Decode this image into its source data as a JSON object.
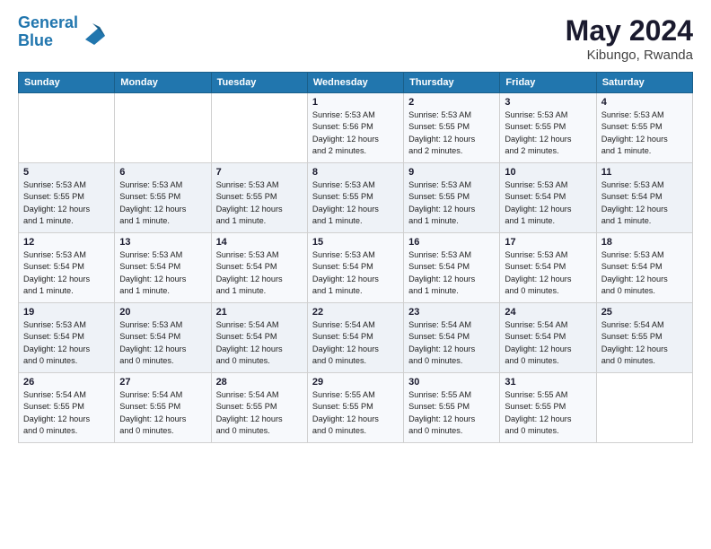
{
  "header": {
    "logo_line1": "General",
    "logo_line2": "Blue",
    "month_year": "May 2024",
    "location": "Kibungo, Rwanda"
  },
  "days_of_week": [
    "Sunday",
    "Monday",
    "Tuesday",
    "Wednesday",
    "Thursday",
    "Friday",
    "Saturday"
  ],
  "weeks": [
    [
      {
        "day": "",
        "text": ""
      },
      {
        "day": "",
        "text": ""
      },
      {
        "day": "",
        "text": ""
      },
      {
        "day": "1",
        "text": "Sunrise: 5:53 AM\nSunset: 5:56 PM\nDaylight: 12 hours\nand 2 minutes."
      },
      {
        "day": "2",
        "text": "Sunrise: 5:53 AM\nSunset: 5:55 PM\nDaylight: 12 hours\nand 2 minutes."
      },
      {
        "day": "3",
        "text": "Sunrise: 5:53 AM\nSunset: 5:55 PM\nDaylight: 12 hours\nand 2 minutes."
      },
      {
        "day": "4",
        "text": "Sunrise: 5:53 AM\nSunset: 5:55 PM\nDaylight: 12 hours\nand 1 minute."
      }
    ],
    [
      {
        "day": "5",
        "text": "Sunrise: 5:53 AM\nSunset: 5:55 PM\nDaylight: 12 hours\nand 1 minute."
      },
      {
        "day": "6",
        "text": "Sunrise: 5:53 AM\nSunset: 5:55 PM\nDaylight: 12 hours\nand 1 minute."
      },
      {
        "day": "7",
        "text": "Sunrise: 5:53 AM\nSunset: 5:55 PM\nDaylight: 12 hours\nand 1 minute."
      },
      {
        "day": "8",
        "text": "Sunrise: 5:53 AM\nSunset: 5:55 PM\nDaylight: 12 hours\nand 1 minute."
      },
      {
        "day": "9",
        "text": "Sunrise: 5:53 AM\nSunset: 5:55 PM\nDaylight: 12 hours\nand 1 minute."
      },
      {
        "day": "10",
        "text": "Sunrise: 5:53 AM\nSunset: 5:54 PM\nDaylight: 12 hours\nand 1 minute."
      },
      {
        "day": "11",
        "text": "Sunrise: 5:53 AM\nSunset: 5:54 PM\nDaylight: 12 hours\nand 1 minute."
      }
    ],
    [
      {
        "day": "12",
        "text": "Sunrise: 5:53 AM\nSunset: 5:54 PM\nDaylight: 12 hours\nand 1 minute."
      },
      {
        "day": "13",
        "text": "Sunrise: 5:53 AM\nSunset: 5:54 PM\nDaylight: 12 hours\nand 1 minute."
      },
      {
        "day": "14",
        "text": "Sunrise: 5:53 AM\nSunset: 5:54 PM\nDaylight: 12 hours\nand 1 minute."
      },
      {
        "day": "15",
        "text": "Sunrise: 5:53 AM\nSunset: 5:54 PM\nDaylight: 12 hours\nand 1 minute."
      },
      {
        "day": "16",
        "text": "Sunrise: 5:53 AM\nSunset: 5:54 PM\nDaylight: 12 hours\nand 1 minute."
      },
      {
        "day": "17",
        "text": "Sunrise: 5:53 AM\nSunset: 5:54 PM\nDaylight: 12 hours\nand 0 minutes."
      },
      {
        "day": "18",
        "text": "Sunrise: 5:53 AM\nSunset: 5:54 PM\nDaylight: 12 hours\nand 0 minutes."
      }
    ],
    [
      {
        "day": "19",
        "text": "Sunrise: 5:53 AM\nSunset: 5:54 PM\nDaylight: 12 hours\nand 0 minutes."
      },
      {
        "day": "20",
        "text": "Sunrise: 5:53 AM\nSunset: 5:54 PM\nDaylight: 12 hours\nand 0 minutes."
      },
      {
        "day": "21",
        "text": "Sunrise: 5:54 AM\nSunset: 5:54 PM\nDaylight: 12 hours\nand 0 minutes."
      },
      {
        "day": "22",
        "text": "Sunrise: 5:54 AM\nSunset: 5:54 PM\nDaylight: 12 hours\nand 0 minutes."
      },
      {
        "day": "23",
        "text": "Sunrise: 5:54 AM\nSunset: 5:54 PM\nDaylight: 12 hours\nand 0 minutes."
      },
      {
        "day": "24",
        "text": "Sunrise: 5:54 AM\nSunset: 5:54 PM\nDaylight: 12 hours\nand 0 minutes."
      },
      {
        "day": "25",
        "text": "Sunrise: 5:54 AM\nSunset: 5:55 PM\nDaylight: 12 hours\nand 0 minutes."
      }
    ],
    [
      {
        "day": "26",
        "text": "Sunrise: 5:54 AM\nSunset: 5:55 PM\nDaylight: 12 hours\nand 0 minutes."
      },
      {
        "day": "27",
        "text": "Sunrise: 5:54 AM\nSunset: 5:55 PM\nDaylight: 12 hours\nand 0 minutes."
      },
      {
        "day": "28",
        "text": "Sunrise: 5:54 AM\nSunset: 5:55 PM\nDaylight: 12 hours\nand 0 minutes."
      },
      {
        "day": "29",
        "text": "Sunrise: 5:55 AM\nSunset: 5:55 PM\nDaylight: 12 hours\nand 0 minutes."
      },
      {
        "day": "30",
        "text": "Sunrise: 5:55 AM\nSunset: 5:55 PM\nDaylight: 12 hours\nand 0 minutes."
      },
      {
        "day": "31",
        "text": "Sunrise: 5:55 AM\nSunset: 5:55 PM\nDaylight: 12 hours\nand 0 minutes."
      },
      {
        "day": "",
        "text": ""
      }
    ]
  ]
}
